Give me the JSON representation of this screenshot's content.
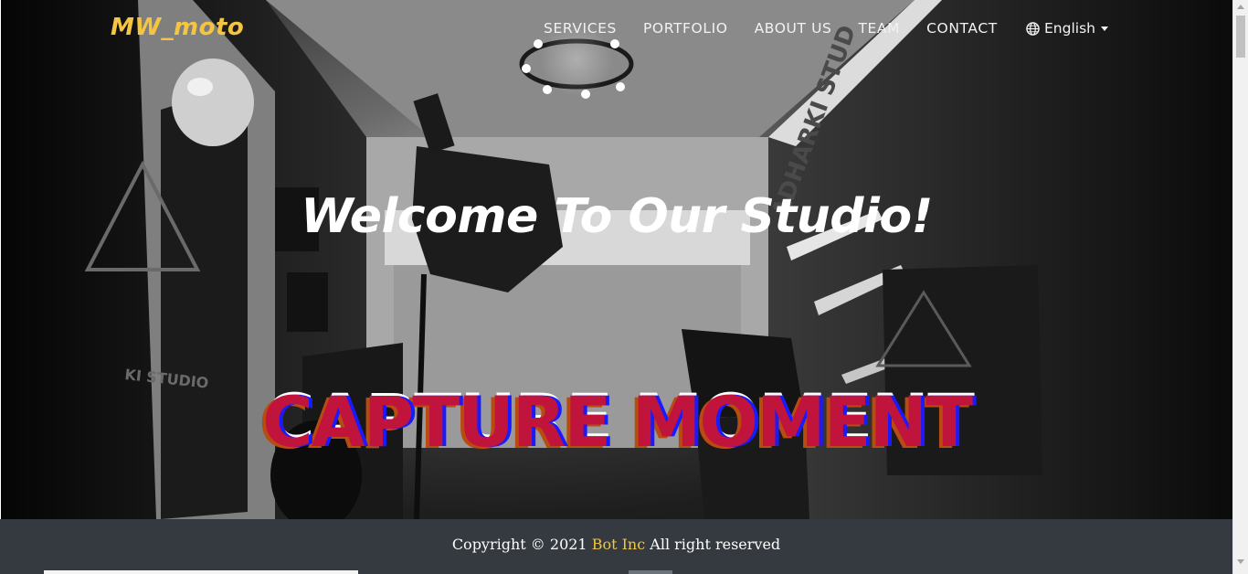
{
  "app": {
    "brand": "MW_moto",
    "colors": {
      "brand": "#f5c542",
      "footer_bg": "#343a40",
      "capture_primary": "#c0143c",
      "capture_secondary": "#1a1aff",
      "capture_tertiary": "#b84b10"
    }
  },
  "nav": {
    "items": [
      {
        "label": "SERVICES"
      },
      {
        "label": "PORTFOLIO"
      },
      {
        "label": "ABOUT US"
      },
      {
        "label": "TEAM"
      },
      {
        "label": "CONTACT"
      }
    ],
    "language": {
      "icon": "globe-icon",
      "selected": "English",
      "caret_icon": "caret-down-icon"
    }
  },
  "hero": {
    "headline": "Welcome To Our Studio!",
    "tagline": "CAPTURE MOMENT",
    "background_icon": "photo-studio-background"
  },
  "footer": {
    "prefix": "Copyright © 2021 ",
    "company": "Bot Inc",
    "suffix": " All right reserved"
  }
}
